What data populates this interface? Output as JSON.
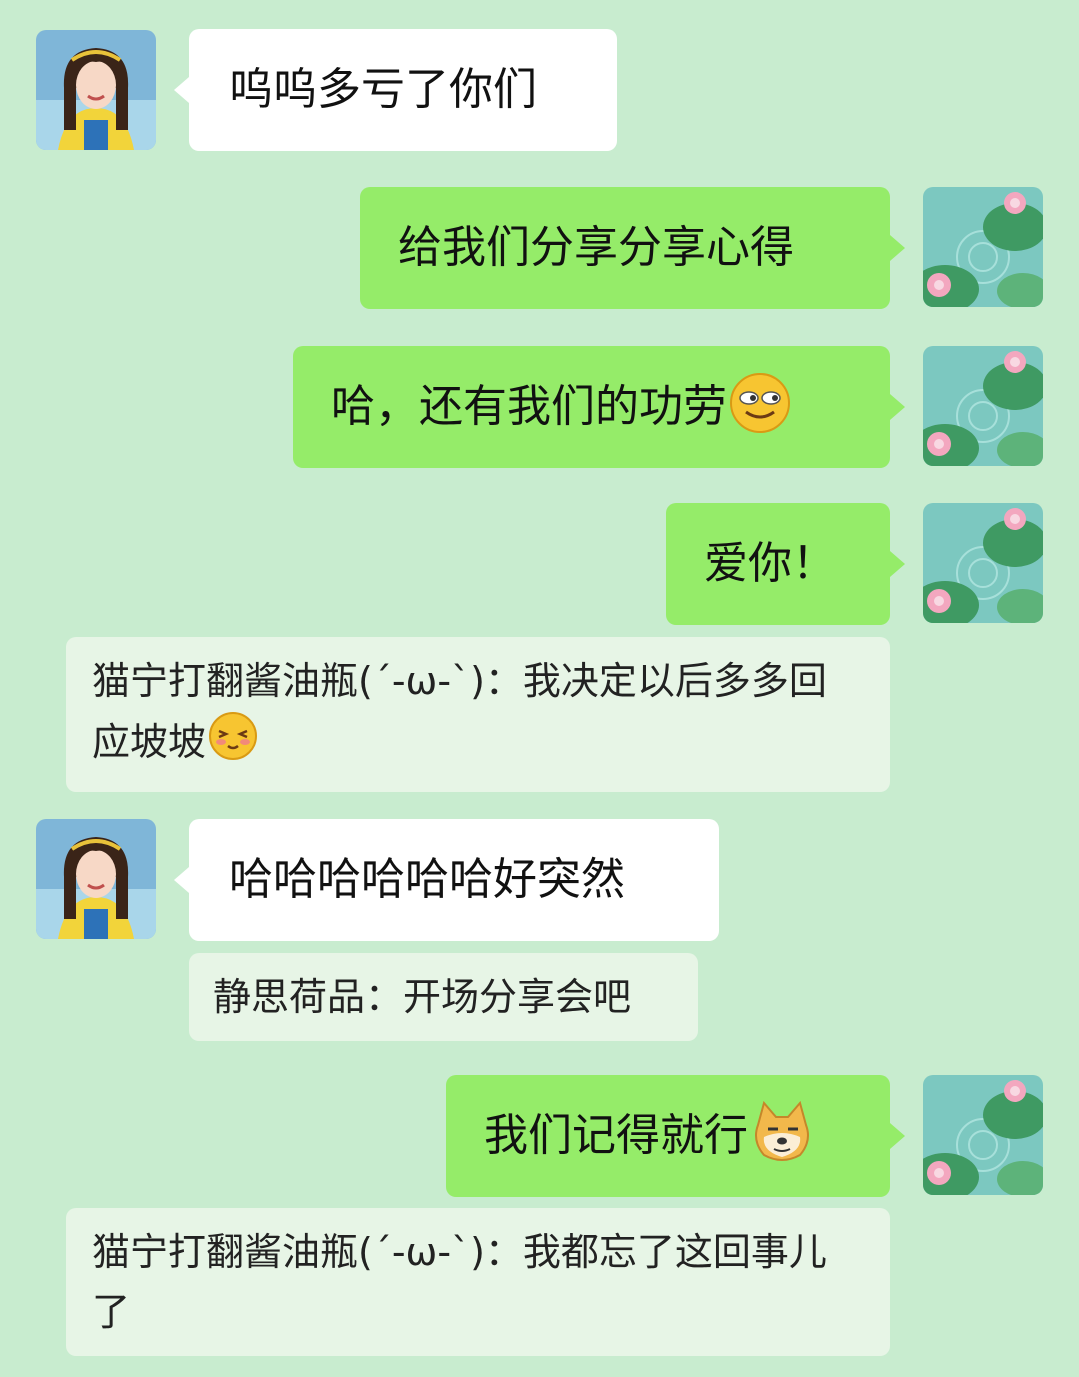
{
  "messages": [
    {
      "side": "left",
      "text": "呜呜多亏了你们"
    },
    {
      "side": "right",
      "text": "给我们分享分享心得"
    },
    {
      "side": "right",
      "text": "哈，还有我们的功劳",
      "emoji": "smirk-face-emoji"
    },
    {
      "side": "right",
      "text": "爱你！"
    },
    {
      "quote": "猫宁打翻酱油瓶(´-ω-`)：我决定以后多多回应坡坡",
      "emoji": "shy-face-emoji"
    },
    {
      "side": "left",
      "text": "哈哈哈哈哈哈好突然"
    },
    {
      "quote": "静思荷品：开场分享会吧"
    },
    {
      "side": "right",
      "text": "我们记得就行",
      "emoji": "doge-emoji"
    },
    {
      "quote": "猫宁打翻酱油瓶(´-ω-`)：我都忘了这回事儿了"
    }
  ],
  "avatars": {
    "left": "girl-avatar",
    "right": "lotus-pond-avatar"
  },
  "colors": {
    "background": "#c8eccf",
    "outgoing_bubble": "#95ec69",
    "incoming_bubble": "#ffffff",
    "quote_bubble": "#e7f5e6"
  }
}
